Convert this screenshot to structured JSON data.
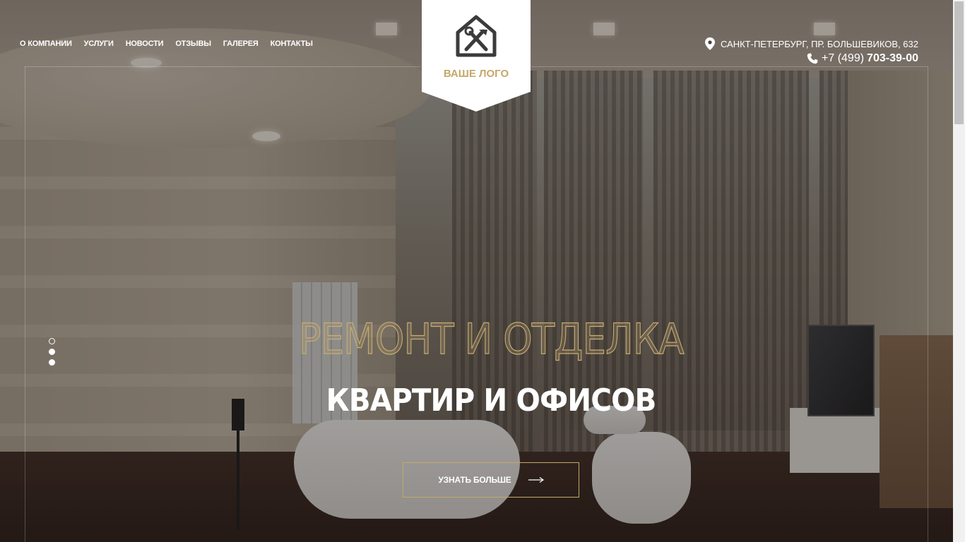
{
  "nav": {
    "items": [
      {
        "label": "О КОМПАНИИ"
      },
      {
        "label": "УСЛУГИ"
      },
      {
        "label": "НОВОСТИ"
      },
      {
        "label": "ОТЗЫВЫ"
      },
      {
        "label": "ГАЛЕРЕЯ"
      },
      {
        "label": "КОНТАКТЫ"
      }
    ]
  },
  "logo": {
    "text": "ВАШЕ ЛОГО",
    "icon": "house-tools-icon"
  },
  "contacts": {
    "address": "САНКТ-ПЕТЕРБУРГ, ПР. БОЛЬШЕВИКОВ, 632",
    "address_icon": "map-pin-icon",
    "phone_prefix": "+7 (499)",
    "phone_number": "703-39-00",
    "phone_icon": "phone-icon"
  },
  "hero": {
    "title": "РЕМОНТ И ОТДЕЛКА",
    "subtitle": "КВАРТИР И ОФИСОВ",
    "cta_label": "УЗНАТЬ БОЛЬШЕ",
    "cta_icon": "arrow-right-icon"
  },
  "slider": {
    "slide_count": 3,
    "active_index": 0
  },
  "colors": {
    "accent": "#c4a86a",
    "text": "#ffffff"
  }
}
